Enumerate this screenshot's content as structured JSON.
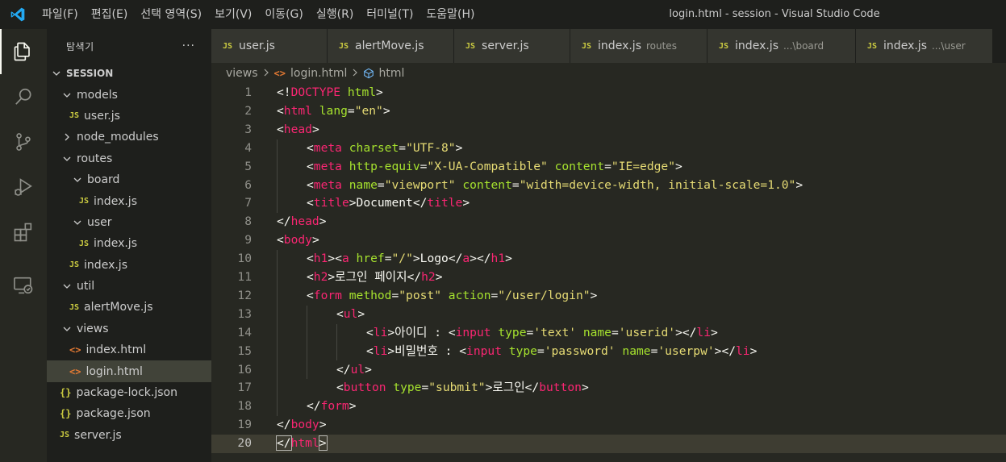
{
  "window": {
    "title": "login.html - session - Visual Studio Code",
    "menu": [
      "파일(F)",
      "편집(E)",
      "선택 영역(S)",
      "보기(V)",
      "이동(G)",
      "실행(R)",
      "터미널(T)",
      "도움말(H)"
    ]
  },
  "activity_bar": [
    "files-icon",
    "search-icon",
    "source-control-icon",
    "run-debug-icon",
    "extensions-icon",
    "remote-explorer-icon"
  ],
  "sidebar": {
    "title": "탐색기",
    "more": "···",
    "tree": [
      {
        "label": "SESSION",
        "type": "root",
        "depth": 0,
        "expanded": true
      },
      {
        "label": "models",
        "type": "folder",
        "depth": 1,
        "expanded": true
      },
      {
        "label": "user.js",
        "type": "js",
        "depth": 2
      },
      {
        "label": "node_modules",
        "type": "folder",
        "depth": 1,
        "expanded": false
      },
      {
        "label": "routes",
        "type": "folder",
        "depth": 1,
        "expanded": true
      },
      {
        "label": "board",
        "type": "folder",
        "depth": 2,
        "expanded": true
      },
      {
        "label": "index.js",
        "type": "js",
        "depth": 3
      },
      {
        "label": "user",
        "type": "folder",
        "depth": 2,
        "expanded": true
      },
      {
        "label": "index.js",
        "type": "js",
        "depth": 3
      },
      {
        "label": "index.js",
        "type": "js",
        "depth": 2
      },
      {
        "label": "util",
        "type": "folder",
        "depth": 1,
        "expanded": true
      },
      {
        "label": "alertMove.js",
        "type": "js",
        "depth": 2
      },
      {
        "label": "views",
        "type": "folder",
        "depth": 1,
        "expanded": true
      },
      {
        "label": "index.html",
        "type": "html",
        "depth": 2
      },
      {
        "label": "login.html",
        "type": "html",
        "depth": 2,
        "selected": true
      },
      {
        "label": "package-lock.json",
        "type": "json",
        "depth": 1
      },
      {
        "label": "package.json",
        "type": "json",
        "depth": 1
      },
      {
        "label": "server.js",
        "type": "js",
        "depth": 1
      }
    ]
  },
  "tabs": [
    {
      "label": "user.js",
      "desc": ""
    },
    {
      "label": "alertMove.js",
      "desc": ""
    },
    {
      "label": "server.js",
      "desc": ""
    },
    {
      "label": "index.js",
      "desc": "routes"
    },
    {
      "label": "index.js",
      "desc": "...\\board"
    },
    {
      "label": "index.js",
      "desc": "...\\user"
    }
  ],
  "breadcrumb": {
    "folder": "views",
    "file": "login.html",
    "symbol": "html"
  },
  "editor": {
    "current_line": 20,
    "lines": [
      {
        "n": "1",
        "indent": 0,
        "tokens": [
          [
            "punc",
            "<!"
          ],
          [
            "tag",
            "DOCTYPE"
          ],
          [
            "punc",
            " "
          ],
          [
            "attr",
            "html"
          ],
          [
            "punc",
            ">"
          ]
        ]
      },
      {
        "n": "2",
        "indent": 0,
        "tokens": [
          [
            "punc",
            "<"
          ],
          [
            "tag",
            "html"
          ],
          [
            "punc",
            " "
          ],
          [
            "attr",
            "lang"
          ],
          [
            "punc",
            "="
          ],
          [
            "str",
            "\"en\""
          ],
          [
            "punc",
            ">"
          ]
        ]
      },
      {
        "n": "3",
        "indent": 0,
        "tokens": [
          [
            "punc",
            "<"
          ],
          [
            "tag",
            "head"
          ],
          [
            "punc",
            ">"
          ]
        ]
      },
      {
        "n": "4",
        "indent": 1,
        "tokens": [
          [
            "punc",
            "<"
          ],
          [
            "tag",
            "meta"
          ],
          [
            "punc",
            " "
          ],
          [
            "attr",
            "charset"
          ],
          [
            "punc",
            "="
          ],
          [
            "str",
            "\"UTF-8\""
          ],
          [
            "punc",
            ">"
          ]
        ]
      },
      {
        "n": "5",
        "indent": 1,
        "tokens": [
          [
            "punc",
            "<"
          ],
          [
            "tag",
            "meta"
          ],
          [
            "punc",
            " "
          ],
          [
            "attr",
            "http-equiv"
          ],
          [
            "punc",
            "="
          ],
          [
            "str",
            "\"X-UA-Compatible\""
          ],
          [
            "punc",
            " "
          ],
          [
            "attr",
            "content"
          ],
          [
            "punc",
            "="
          ],
          [
            "str",
            "\"IE=edge\""
          ],
          [
            "punc",
            ">"
          ]
        ]
      },
      {
        "n": "6",
        "indent": 1,
        "tokens": [
          [
            "punc",
            "<"
          ],
          [
            "tag",
            "meta"
          ],
          [
            "punc",
            " "
          ],
          [
            "attr",
            "name"
          ],
          [
            "punc",
            "="
          ],
          [
            "str",
            "\"viewport\""
          ],
          [
            "punc",
            " "
          ],
          [
            "attr",
            "content"
          ],
          [
            "punc",
            "="
          ],
          [
            "str",
            "\"width=device-width, initial-scale=1.0\""
          ],
          [
            "punc",
            ">"
          ]
        ]
      },
      {
        "n": "7",
        "indent": 1,
        "tokens": [
          [
            "punc",
            "<"
          ],
          [
            "tag",
            "title"
          ],
          [
            "punc",
            ">"
          ],
          [
            "text",
            "Document"
          ],
          [
            "punc",
            "</"
          ],
          [
            "tag",
            "title"
          ],
          [
            "punc",
            ">"
          ]
        ]
      },
      {
        "n": "8",
        "indent": 0,
        "tokens": [
          [
            "punc",
            "</"
          ],
          [
            "tag",
            "head"
          ],
          [
            "punc",
            ">"
          ]
        ]
      },
      {
        "n": "9",
        "indent": 0,
        "tokens": [
          [
            "punc",
            "<"
          ],
          [
            "tag",
            "body"
          ],
          [
            "punc",
            ">"
          ]
        ]
      },
      {
        "n": "10",
        "indent": 1,
        "tokens": [
          [
            "punc",
            "<"
          ],
          [
            "tag",
            "h1"
          ],
          [
            "punc",
            "><"
          ],
          [
            "tag",
            "a"
          ],
          [
            "punc",
            " "
          ],
          [
            "attr",
            "href"
          ],
          [
            "punc",
            "="
          ],
          [
            "str",
            "\"/\""
          ],
          [
            "punc",
            ">"
          ],
          [
            "text",
            "Logo"
          ],
          [
            "punc",
            "</"
          ],
          [
            "tag",
            "a"
          ],
          [
            "punc",
            "></"
          ],
          [
            "tag",
            "h1"
          ],
          [
            "punc",
            ">"
          ]
        ]
      },
      {
        "n": "11",
        "indent": 1,
        "tokens": [
          [
            "punc",
            "<"
          ],
          [
            "tag",
            "h2"
          ],
          [
            "punc",
            ">"
          ],
          [
            "text",
            "로그인 페이지"
          ],
          [
            "punc",
            "</"
          ],
          [
            "tag",
            "h2"
          ],
          [
            "punc",
            ">"
          ]
        ]
      },
      {
        "n": "12",
        "indent": 1,
        "tokens": [
          [
            "punc",
            "<"
          ],
          [
            "tag",
            "form"
          ],
          [
            "punc",
            " "
          ],
          [
            "attr",
            "method"
          ],
          [
            "punc",
            "="
          ],
          [
            "str",
            "\"post\""
          ],
          [
            "punc",
            " "
          ],
          [
            "attr",
            "action"
          ],
          [
            "punc",
            "="
          ],
          [
            "str",
            "\"/user/login\""
          ],
          [
            "punc",
            ">"
          ]
        ]
      },
      {
        "n": "13",
        "indent": 2,
        "tokens": [
          [
            "punc",
            "<"
          ],
          [
            "tag",
            "ul"
          ],
          [
            "punc",
            ">"
          ]
        ]
      },
      {
        "n": "14",
        "indent": 3,
        "tokens": [
          [
            "punc",
            "<"
          ],
          [
            "tag",
            "li"
          ],
          [
            "punc",
            ">"
          ],
          [
            "text",
            "아이디 : "
          ],
          [
            "punc",
            "<"
          ],
          [
            "tag",
            "input"
          ],
          [
            "punc",
            " "
          ],
          [
            "attr",
            "type"
          ],
          [
            "punc",
            "="
          ],
          [
            "str",
            "'text'"
          ],
          [
            "punc",
            " "
          ],
          [
            "attr",
            "name"
          ],
          [
            "punc",
            "="
          ],
          [
            "str",
            "'userid'"
          ],
          [
            "punc",
            "></"
          ],
          [
            "tag",
            "li"
          ],
          [
            "punc",
            ">"
          ]
        ]
      },
      {
        "n": "15",
        "indent": 3,
        "tokens": [
          [
            "punc",
            "<"
          ],
          [
            "tag",
            "li"
          ],
          [
            "punc",
            ">"
          ],
          [
            "text",
            "비밀번호 : "
          ],
          [
            "punc",
            "<"
          ],
          [
            "tag",
            "input"
          ],
          [
            "punc",
            " "
          ],
          [
            "attr",
            "type"
          ],
          [
            "punc",
            "="
          ],
          [
            "str",
            "'password'"
          ],
          [
            "punc",
            " "
          ],
          [
            "attr",
            "name"
          ],
          [
            "punc",
            "="
          ],
          [
            "str",
            "'userpw'"
          ],
          [
            "punc",
            "></"
          ],
          [
            "tag",
            "li"
          ],
          [
            "punc",
            ">"
          ]
        ]
      },
      {
        "n": "16",
        "indent": 2,
        "tokens": [
          [
            "punc",
            "</"
          ],
          [
            "tag",
            "ul"
          ],
          [
            "punc",
            ">"
          ]
        ]
      },
      {
        "n": "17",
        "indent": 2,
        "tokens": [
          [
            "punc",
            "<"
          ],
          [
            "tag",
            "button"
          ],
          [
            "punc",
            " "
          ],
          [
            "attr",
            "type"
          ],
          [
            "punc",
            "="
          ],
          [
            "str",
            "\"submit\""
          ],
          [
            "punc",
            ">"
          ],
          [
            "text",
            "로그인"
          ],
          [
            "punc",
            "</"
          ],
          [
            "tag",
            "button"
          ],
          [
            "punc",
            ">"
          ]
        ]
      },
      {
        "n": "18",
        "indent": 1,
        "tokens": [
          [
            "punc",
            "</"
          ],
          [
            "tag",
            "form"
          ],
          [
            "punc",
            ">"
          ]
        ]
      },
      {
        "n": "19",
        "indent": 0,
        "tokens": [
          [
            "punc",
            "</"
          ],
          [
            "tag",
            "body"
          ],
          [
            "punc",
            ">"
          ]
        ]
      },
      {
        "n": "20",
        "indent": 0,
        "tokens": [
          [
            "punc",
            "</"
          ],
          [
            "tag",
            "html"
          ],
          [
            "punc",
            ">"
          ]
        ]
      }
    ]
  },
  "colors": {
    "tag": "#f92672",
    "attr": "#a6e22e",
    "string": "#e6db74",
    "text": "#f8f8f2",
    "editor_bg": "#272822",
    "sidebar_bg": "#1e1f1c",
    "selection": "#414339",
    "vscode_blue": "#23a9f2"
  }
}
